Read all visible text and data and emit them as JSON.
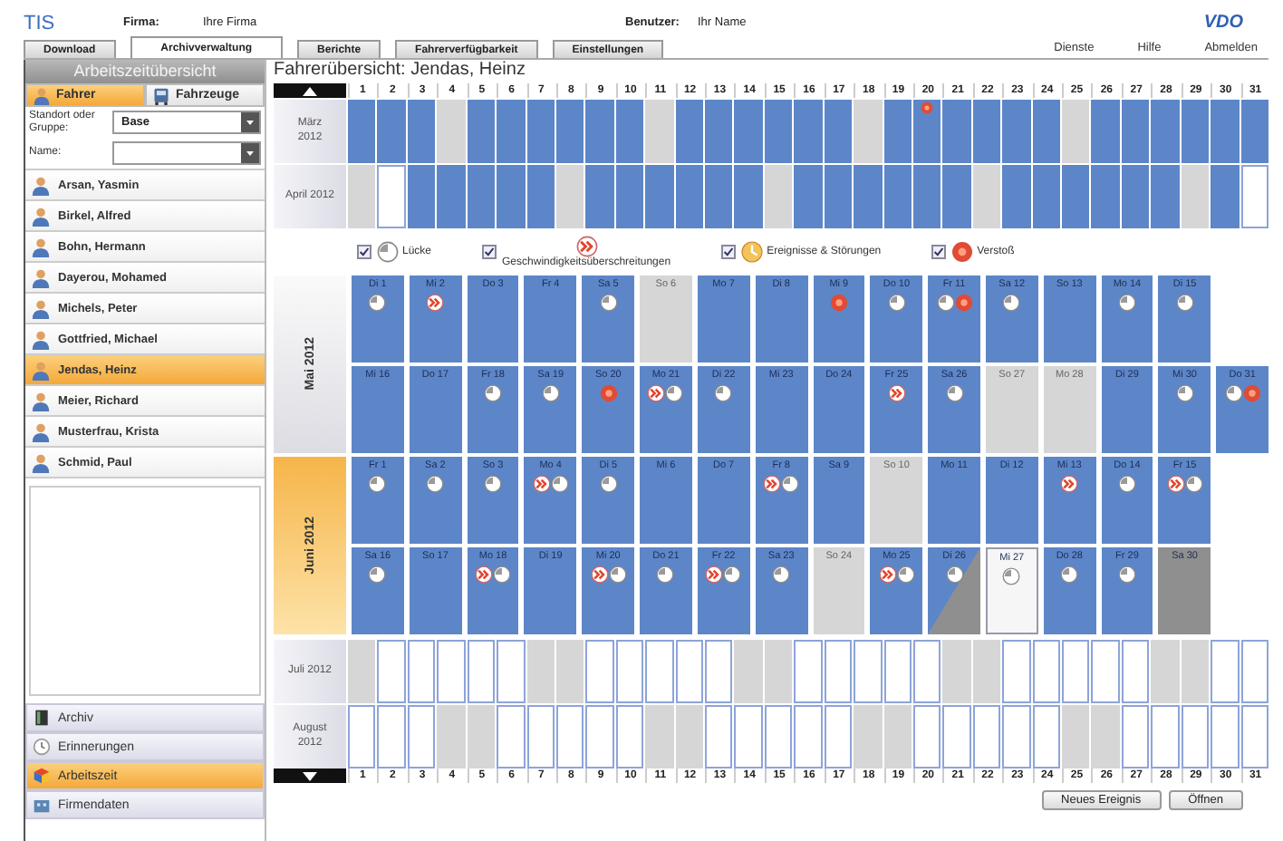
{
  "header": {
    "logo": "TIS",
    "company_label": "Firma:",
    "company": "Ihre Firma",
    "user_label": "Benutzer:",
    "user": "Ihr Name",
    "brand": "VDO"
  },
  "tabs": [
    {
      "label": "Download",
      "selected": false
    },
    {
      "label": "Archivverwaltung",
      "selected": true
    },
    {
      "label": "Berichte",
      "selected": false
    },
    {
      "label": "Fahrerverfügbarkeit",
      "selected": false
    },
    {
      "label": "Einstellungen",
      "selected": false
    }
  ],
  "top_links": [
    "Dienste",
    "Hilfe",
    "Abmelden"
  ],
  "sidebar": {
    "title": "Arbeitszeitübersicht",
    "toggle": [
      {
        "label": "Fahrer",
        "selected": true
      },
      {
        "label": "Fahrzeuge",
        "selected": false
      }
    ],
    "group_field": {
      "label": "Standort oder Gruppe:",
      "value": "Base"
    },
    "name_field": {
      "label": "Name:"
    },
    "drivers": [
      {
        "name": "Arsan, Yasmin",
        "selected": false
      },
      {
        "name": "Birkel, Alfred",
        "selected": false
      },
      {
        "name": "Bohn, Hermann",
        "selected": false
      },
      {
        "name": "Dayerou, Mohamed",
        "selected": false
      },
      {
        "name": "Michels, Peter",
        "selected": false
      },
      {
        "name": "Gottfried, Michael",
        "selected": false
      },
      {
        "name": "Jendas, Heinz",
        "selected": true
      },
      {
        "name": "Meier, Richard",
        "selected": false
      },
      {
        "name": "Musterfrau, Krista",
        "selected": false
      },
      {
        "name": "Schmid, Paul",
        "selected": false
      }
    ],
    "nav": [
      {
        "label": "Archiv",
        "selected": false
      },
      {
        "label": "Erinnerungen",
        "selected": false
      },
      {
        "label": "Arbeitszeit",
        "selected": true
      },
      {
        "label": "Firmendaten",
        "selected": false
      }
    ]
  },
  "title": "Fahrerübersicht: Jendas, Heinz",
  "day_header": [
    "1",
    "2",
    "3",
    "4",
    "5",
    "6",
    "7",
    "8",
    "9",
    "10",
    "11",
    "12",
    "13",
    "14",
    "15",
    "16",
    "17",
    "18",
    "19",
    "20",
    "21",
    "22",
    "23",
    "24",
    "25",
    "26",
    "27",
    "28",
    "29",
    "30",
    "31"
  ],
  "months_before": [
    {
      "label": "März 2012",
      "days": [
        {
          "kind": "work"
        },
        {
          "kind": "work"
        },
        {
          "kind": "work"
        },
        {
          "kind": "free"
        },
        {
          "kind": "work"
        },
        {
          "kind": "work"
        },
        {
          "kind": "work"
        },
        {
          "kind": "work"
        },
        {
          "kind": "work"
        },
        {
          "kind": "work"
        },
        {
          "kind": "free"
        },
        {
          "kind": "work"
        },
        {
          "kind": "work"
        },
        {
          "kind": "work"
        },
        {
          "kind": "work"
        },
        {
          "kind": "work"
        },
        {
          "kind": "work"
        },
        {
          "kind": "free"
        },
        {
          "kind": "work"
        },
        {
          "kind": "work",
          "icons": [
            {
              "kind": "violation"
            }
          ]
        },
        {
          "kind": "work"
        },
        {
          "kind": "work"
        },
        {
          "kind": "work"
        },
        {
          "kind": "work"
        },
        {
          "kind": "free"
        },
        {
          "kind": "work"
        },
        {
          "kind": "work"
        },
        {
          "kind": "work"
        },
        {
          "kind": "work"
        },
        {
          "kind": "work"
        },
        {
          "kind": "work"
        }
      ]
    },
    {
      "label": "April 2012",
      "days": [
        {
          "kind": "free"
        },
        {
          "kind": "empty"
        },
        {
          "kind": "work"
        },
        {
          "kind": "work"
        },
        {
          "kind": "work"
        },
        {
          "kind": "work"
        },
        {
          "kind": "work"
        },
        {
          "kind": "free"
        },
        {
          "kind": "work"
        },
        {
          "kind": "work"
        },
        {
          "kind": "work"
        },
        {
          "kind": "work"
        },
        {
          "kind": "work"
        },
        {
          "kind": "work"
        },
        {
          "kind": "free"
        },
        {
          "kind": "work"
        },
        {
          "kind": "work"
        },
        {
          "kind": "work"
        },
        {
          "kind": "work"
        },
        {
          "kind": "work"
        },
        {
          "kind": "work"
        },
        {
          "kind": "free"
        },
        {
          "kind": "work"
        },
        {
          "kind": "work"
        },
        {
          "kind": "work"
        },
        {
          "kind": "work"
        },
        {
          "kind": "work"
        },
        {
          "kind": "work"
        },
        {
          "kind": "free"
        },
        {
          "kind": "work"
        },
        {
          "kind": "empty"
        }
      ]
    }
  ],
  "legend": [
    {
      "label": "Lücke",
      "checked": true,
      "kind": "clock",
      "stacked": false
    },
    {
      "label": "Geschwindigkeitsüberschreitungen",
      "checked": true,
      "kind": "speed",
      "stacked": true
    },
    {
      "label": "Ereignisse & Störungen",
      "checked": true,
      "kind": "event",
      "stacked": false
    },
    {
      "label": "Verstoß",
      "checked": true,
      "kind": "violation",
      "stacked": false
    }
  ],
  "months": [
    {
      "label": "Mai 2012",
      "selected": false,
      "rows": [
        [
          {
            "label": "Di 1",
            "kind": "work",
            "icons": [
              {
                "kind": "clock"
              }
            ]
          },
          {
            "label": "Mi 2",
            "kind": "work",
            "icons": [
              {
                "kind": "speed"
              }
            ]
          },
          {
            "label": "Do 3",
            "kind": "work"
          },
          {
            "label": "Fr 4",
            "kind": "work"
          },
          {
            "label": "Sa 5",
            "kind": "work",
            "icons": [
              {
                "kind": "clock"
              }
            ]
          },
          {
            "label": "So 6",
            "kind": "free"
          },
          {
            "label": "Mo 7",
            "kind": "work"
          },
          {
            "label": "Di 8",
            "kind": "work"
          },
          {
            "label": "Mi 9",
            "kind": "work",
            "icons": [
              {
                "kind": "violation"
              }
            ]
          },
          {
            "label": "Do 10",
            "kind": "work",
            "icons": [
              {
                "kind": "clock"
              }
            ]
          },
          {
            "label": "Fr 11",
            "kind": "work",
            "icons": [
              {
                "kind": "clock"
              },
              {
                "kind": "violation"
              }
            ]
          },
          {
            "label": "Sa 12",
            "kind": "work",
            "icons": [
              {
                "kind": "clock"
              }
            ]
          },
          {
            "label": "So 13",
            "kind": "work"
          },
          {
            "label": "Mo 14",
            "kind": "work",
            "icons": [
              {
                "kind": "clock"
              }
            ]
          },
          {
            "label": "Di 15",
            "kind": "work",
            "icons": [
              {
                "kind": "clock"
              }
            ]
          }
        ],
        [
          {
            "label": "Mi 16",
            "kind": "work"
          },
          {
            "label": "Do 17",
            "kind": "work"
          },
          {
            "label": "Fr 18",
            "kind": "work",
            "icons": [
              {
                "kind": "clock"
              }
            ]
          },
          {
            "label": "Sa 19",
            "kind": "work",
            "icons": [
              {
                "kind": "clock"
              }
            ]
          },
          {
            "label": "So 20",
            "kind": "work",
            "icons": [
              {
                "kind": "violation"
              }
            ]
          },
          {
            "label": "Mo 21",
            "kind": "work",
            "icons": [
              {
                "kind": "speed"
              },
              {
                "kind": "clock"
              }
            ]
          },
          {
            "label": "Di 22",
            "kind": "work",
            "icons": [
              {
                "kind": "clock"
              }
            ]
          },
          {
            "label": "Mi 23",
            "kind": "work"
          },
          {
            "label": "Do 24",
            "kind": "work"
          },
          {
            "label": "Fr 25",
            "kind": "work",
            "icons": [
              {
                "kind": "speed"
              }
            ]
          },
          {
            "label": "Sa 26",
            "kind": "work",
            "icons": [
              {
                "kind": "clock"
              }
            ]
          },
          {
            "label": "So 27",
            "kind": "free"
          },
          {
            "label": "Mo 28",
            "kind": "free"
          },
          {
            "label": "Di 29",
            "kind": "work"
          },
          {
            "label": "Mi 30",
            "kind": "work",
            "icons": [
              {
                "kind": "clock"
              }
            ]
          },
          {
            "label": "Do 31",
            "kind": "work",
            "icons": [
              {
                "kind": "clock"
              },
              {
                "kind": "violation"
              }
            ]
          }
        ]
      ]
    },
    {
      "label": "Juni 2012",
      "selected": true,
      "rows": [
        [
          {
            "label": "Fr 1",
            "kind": "work",
            "icons": [
              {
                "kind": "clock"
              }
            ]
          },
          {
            "label": "Sa 2",
            "kind": "work",
            "icons": [
              {
                "kind": "clock"
              }
            ]
          },
          {
            "label": "So 3",
            "kind": "work",
            "icons": [
              {
                "kind": "clock"
              }
            ]
          },
          {
            "label": "Mo 4",
            "kind": "work",
            "icons": [
              {
                "kind": "speed"
              },
              {
                "kind": "clock"
              }
            ]
          },
          {
            "label": "Di 5",
            "kind": "work",
            "icons": [
              {
                "kind": "clock"
              }
            ]
          },
          {
            "label": "Mi 6",
            "kind": "work"
          },
          {
            "label": "Do 7",
            "kind": "work"
          },
          {
            "label": "Fr 8",
            "kind": "work",
            "icons": [
              {
                "kind": "speed"
              },
              {
                "kind": "clock"
              }
            ]
          },
          {
            "label": "Sa 9",
            "kind": "work"
          },
          {
            "label": "So 10",
            "kind": "free"
          },
          {
            "label": "Mo 11",
            "kind": "work"
          },
          {
            "label": "Di 12",
            "kind": "work"
          },
          {
            "label": "Mi 13",
            "kind": "work",
            "icons": [
              {
                "kind": "speed"
              }
            ]
          },
          {
            "label": "Do 14",
            "kind": "work",
            "icons": [
              {
                "kind": "clock"
              }
            ]
          },
          {
            "label": "Fr 15",
            "kind": "work",
            "icons": [
              {
                "kind": "speed"
              },
              {
                "kind": "clock"
              }
            ]
          }
        ],
        [
          {
            "label": "Sa 16",
            "kind": "work",
            "icons": [
              {
                "kind": "clock"
              }
            ]
          },
          {
            "label": "So 17",
            "kind": "work"
          },
          {
            "label": "Mo 18",
            "kind": "work",
            "icons": [
              {
                "kind": "speed"
              },
              {
                "kind": "clock"
              }
            ]
          },
          {
            "label": "Di 19",
            "kind": "work"
          },
          {
            "label": "Mi 20",
            "kind": "work",
            "icons": [
              {
                "kind": "speed"
              },
              {
                "kind": "clock"
              }
            ]
          },
          {
            "label": "Do 21",
            "kind": "work",
            "icons": [
              {
                "kind": "clock"
              }
            ]
          },
          {
            "label": "Fr 22",
            "kind": "work",
            "icons": [
              {
                "kind": "speed"
              },
              {
                "kind": "clock"
              }
            ]
          },
          {
            "label": "Sa 23",
            "kind": "work",
            "icons": [
              {
                "kind": "clock"
              }
            ]
          },
          {
            "label": "So 24",
            "kind": "free"
          },
          {
            "label": "Mo 25",
            "kind": "work",
            "icons": [
              {
                "kind": "speed"
              },
              {
                "kind": "clock"
              }
            ]
          },
          {
            "label": "Di 26",
            "kind": "partial",
            "icons": [
              {
                "kind": "clock"
              }
            ]
          },
          {
            "label": "Mi 27",
            "kind": "open",
            "icons": [
              {
                "kind": "clock"
              }
            ]
          },
          {
            "label": "Do 28",
            "kind": "work",
            "icons": [
              {
                "kind": "clock"
              }
            ]
          },
          {
            "label": "Fr 29",
            "kind": "work",
            "icons": [
              {
                "kind": "clock"
              }
            ]
          },
          {
            "label": "Sa 30",
            "kind": "dark"
          }
        ]
      ]
    }
  ],
  "months_after": [
    {
      "label": "Juli 2012",
      "days": [
        {
          "kind": "free"
        },
        {
          "kind": "empty"
        },
        {
          "kind": "empty"
        },
        {
          "kind": "empty"
        },
        {
          "kind": "empty"
        },
        {
          "kind": "empty"
        },
        {
          "kind": "free"
        },
        {
          "kind": "free"
        },
        {
          "kind": "empty"
        },
        {
          "kind": "empty"
        },
        {
          "kind": "empty"
        },
        {
          "kind": "empty"
        },
        {
          "kind": "empty"
        },
        {
          "kind": "free"
        },
        {
          "kind": "free"
        },
        {
          "kind": "empty"
        },
        {
          "kind": "empty"
        },
        {
          "kind": "empty"
        },
        {
          "kind": "empty"
        },
        {
          "kind": "empty"
        },
        {
          "kind": "free"
        },
        {
          "kind": "free"
        },
        {
          "kind": "empty"
        },
        {
          "kind": "empty"
        },
        {
          "kind": "empty"
        },
        {
          "kind": "empty"
        },
        {
          "kind": "empty"
        },
        {
          "kind": "free"
        },
        {
          "kind": "free"
        },
        {
          "kind": "empty"
        },
        {
          "kind": "empty"
        }
      ]
    },
    {
      "label": "August 2012",
      "days": [
        {
          "kind": "empty"
        },
        {
          "kind": "empty"
        },
        {
          "kind": "empty"
        },
        {
          "kind": "free"
        },
        {
          "kind": "free"
        },
        {
          "kind": "empty"
        },
        {
          "kind": "empty"
        },
        {
          "kind": "empty"
        },
        {
          "kind": "empty"
        },
        {
          "kind": "empty"
        },
        {
          "kind": "free"
        },
        {
          "kind": "free"
        },
        {
          "kind": "empty"
        },
        {
          "kind": "empty"
        },
        {
          "kind": "empty"
        },
        {
          "kind": "empty"
        },
        {
          "kind": "empty"
        },
        {
          "kind": "free"
        },
        {
          "kind": "free"
        },
        {
          "kind": "empty"
        },
        {
          "kind": "empty"
        },
        {
          "kind": "empty"
        },
        {
          "kind": "empty"
        },
        {
          "kind": "empty"
        },
        {
          "kind": "free"
        },
        {
          "kind": "free"
        },
        {
          "kind": "empty"
        },
        {
          "kind": "empty"
        },
        {
          "kind": "empty"
        },
        {
          "kind": "empty"
        },
        {
          "kind": "empty"
        }
      ]
    }
  ],
  "day_footer": [
    "1",
    "2",
    "3",
    "4",
    "5",
    "6",
    "7",
    "8",
    "9",
    "10",
    "11",
    "12",
    "13",
    "14",
    "15",
    "16",
    "17",
    "18",
    "19",
    "20",
    "21",
    "22",
    "23",
    "24",
    "25",
    "26",
    "27",
    "28",
    "29",
    "30",
    "31"
  ],
  "buttons": [
    "Neues Ereignis",
    "Öffnen"
  ]
}
